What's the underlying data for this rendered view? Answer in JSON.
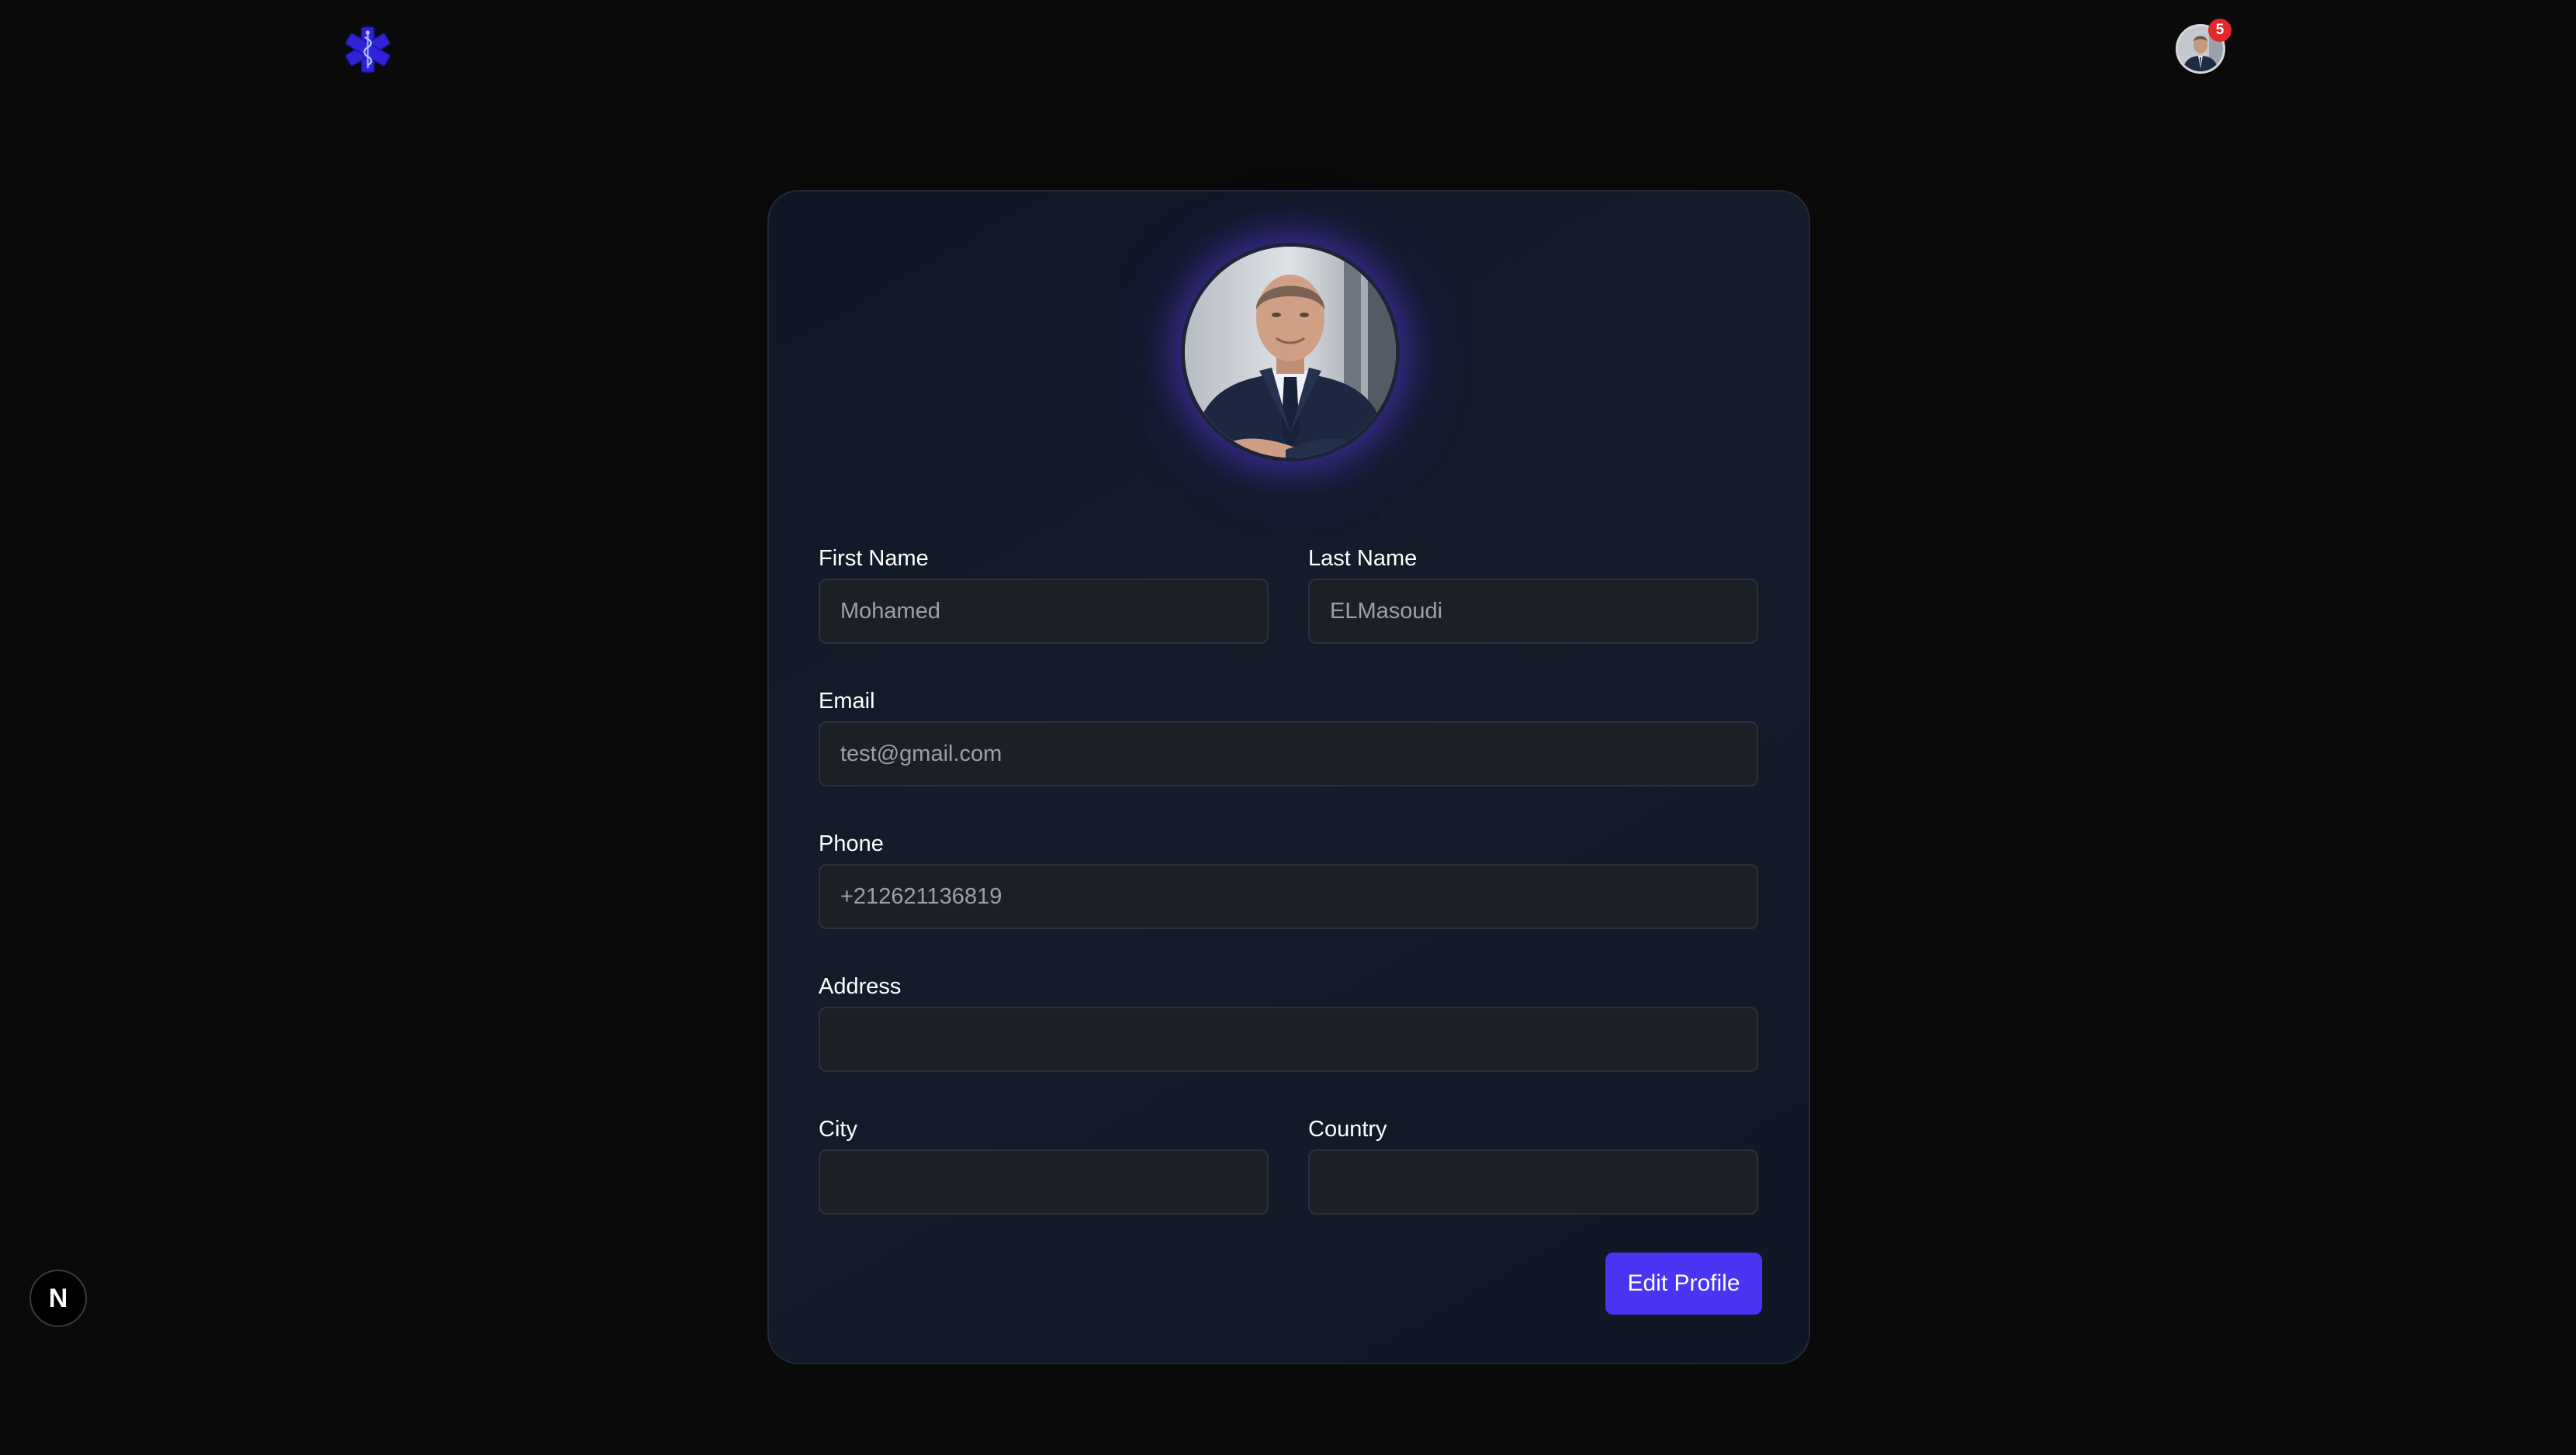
{
  "header": {
    "logo_icon": "star-of-life-icon",
    "notification_count": "5",
    "avatar_icon": "user-avatar"
  },
  "profile": {
    "avatar_icon": "profile-photo",
    "fields": {
      "first_name": {
        "label": "First Name",
        "value": "Mohamed"
      },
      "last_name": {
        "label": "Last Name",
        "value": "ELMasoudi"
      },
      "email": {
        "label": "Email",
        "value": "test@gmail.com"
      },
      "phone": {
        "label": "Phone",
        "value": "+212621136819"
      },
      "address": {
        "label": "Address",
        "value": ""
      },
      "city": {
        "label": "City",
        "value": ""
      },
      "country": {
        "label": "Country",
        "value": ""
      }
    },
    "edit_button_label": "Edit Profile"
  },
  "dev_indicator": {
    "letter": "N"
  },
  "colors": {
    "background": "#0a0a0b",
    "accent": "#4b35f5",
    "badge": "#e5262b",
    "logo": "#2f22d8"
  }
}
